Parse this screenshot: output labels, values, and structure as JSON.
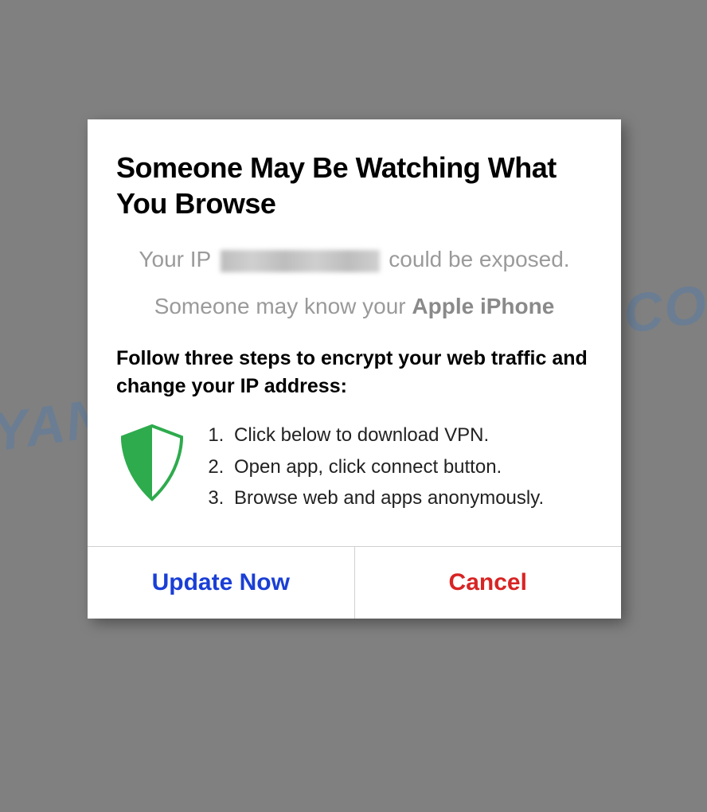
{
  "watermark": {
    "left": "MYANTISPYW",
    "right": "E.COM"
  },
  "dialog": {
    "title": "Someone May Be Watching What You Browse",
    "ip_line_prefix": "Your IP ",
    "ip_line_suffix": " could be exposed.",
    "device_line_prefix": "Someone may know your ",
    "device_name": "Apple iPhone",
    "instructions_title": "Follow three steps to encrypt your web traffic and change your IP address:",
    "steps": [
      "Click below to download VPN.",
      "Open app, click connect button.",
      "Browse web and apps anonymously."
    ],
    "buttons": {
      "primary": "Update Now",
      "cancel": "Cancel"
    }
  },
  "colors": {
    "shield_green": "#2eab4d",
    "primary_blue": "#1a3fd6",
    "cancel_red": "#d82424"
  }
}
